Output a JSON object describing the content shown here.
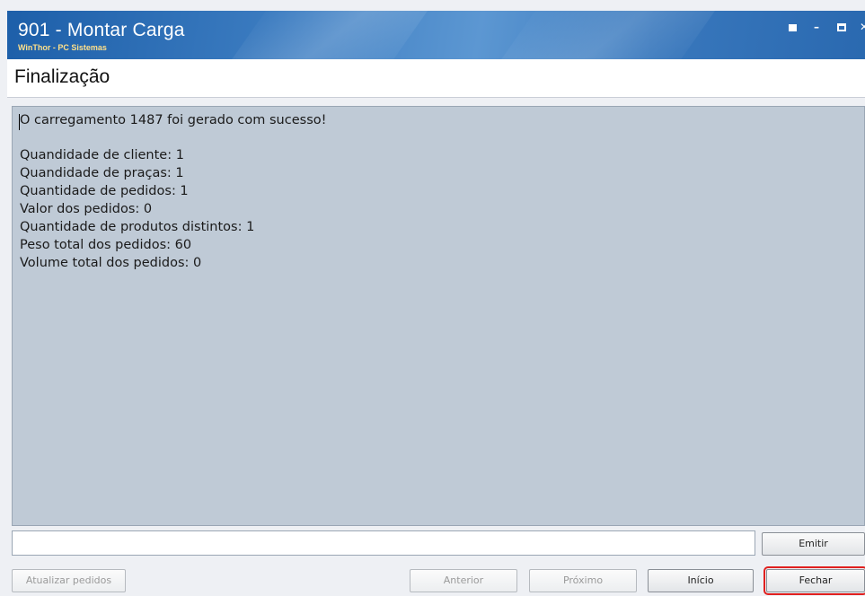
{
  "window": {
    "title": "901 - Montar Carga",
    "subtitle": "WinThor - PC Sistemas",
    "controls": [
      "restore-icon",
      "minimize-icon",
      "maximize-icon",
      "close-icon"
    ]
  },
  "section": {
    "title": "Finalização"
  },
  "message": {
    "headline": "O carregamento 1487 foi gerado com sucesso!",
    "lines": [
      "Quandidade de cliente: 1",
      "Quandidade de praças: 1",
      "Quantidade de pedidos: 1",
      "Valor dos pedidos: 0",
      "Quantidade de produtos distintos: 1",
      "Peso total dos pedidos: 60",
      "Volume total dos pedidos: 0"
    ]
  },
  "input": {
    "value": ""
  },
  "buttons": {
    "emitir": "Emitir",
    "atualizar": "Atualizar pedidos",
    "anterior": "Anterior",
    "proximo": "Próximo",
    "inicio": "Início",
    "fechar": "Fechar"
  },
  "colors": {
    "titlebar": "#2a69b0",
    "panel": "#bfcad6",
    "highlight": "#e0201f"
  }
}
